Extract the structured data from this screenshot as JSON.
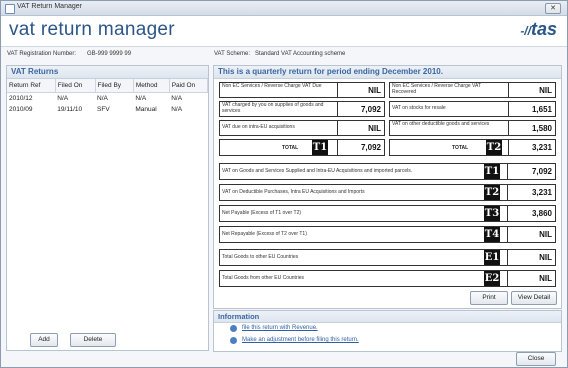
{
  "window": {
    "title": "VAT Return Manager",
    "close_label": "✕"
  },
  "header": {
    "app_title": "vat return manager",
    "logo": "tas"
  },
  "info_bar": {
    "reg_label": "VAT Registration Number:",
    "reg_value": "GB-999 9999 99",
    "scheme_label": "VAT Scheme:",
    "scheme_value": "Standard VAT Accounting scheme"
  },
  "vat_returns": {
    "heading": "VAT Returns",
    "columns": [
      "Return Ref",
      "Filed On",
      "Filed By",
      "Method",
      "Paid On"
    ],
    "rows": [
      [
        "2010/12",
        "N/A",
        "N/A",
        "N/A",
        "N/A"
      ],
      [
        "2010/09",
        "19/11/10",
        "SFV",
        "Manual",
        "N/A"
      ]
    ],
    "add_label": "Add",
    "delete_label": "Delete"
  },
  "return_detail": {
    "heading": "This is a quarterly return for period ending December 2010.",
    "boxes": [
      {
        "label": "Non EC Services / Reverse Charge VAT Due",
        "value": "NIL"
      },
      {
        "label": "Non EC Services / Reverse Charge VAT Recovered",
        "value": "NIL"
      },
      {
        "label": "VAT charged by you on supplies of goods and services",
        "value": "7,092"
      },
      {
        "label": "VAT on stocks for resale",
        "value": "1,651"
      },
      {
        "label": "VAT due on intra-EU acquisitions",
        "value": "NIL"
      },
      {
        "label": "VAT on other deductible goods and services",
        "value": "1,580"
      }
    ],
    "totals": [
      {
        "label": "TOTAL",
        "tag": "T1",
        "value": "7,092"
      },
      {
        "label": "TOTAL",
        "tag": "T2",
        "value": "3,231"
      }
    ],
    "summary_rows": [
      {
        "label": "VAT on Goods and Services Supplied and Intra-EU Acquisitions and imported parcels.",
        "tag": "T1",
        "value": "7,092"
      },
      {
        "label": "VAT on Deductible Purchases, Intra EU Acquisitions and Imports",
        "tag": "T2",
        "value": "3,231"
      },
      {
        "label": "Net Payable (Excess of T1 over T2)",
        "tag": "T3",
        "value": "3,860"
      },
      {
        "label": "Net Repayable (Excess of T2 over T1)",
        "tag": "T4",
        "value": "NIL"
      },
      {
        "label": "Total Goods to other EU Countries",
        "tag": "E1",
        "value": "NIL"
      },
      {
        "label": "Total Goods from other EU Countries",
        "tag": "E2",
        "value": "NIL"
      }
    ],
    "print_label": "Print",
    "view_detail_label": "View Detail"
  },
  "information": {
    "heading": "Information",
    "link1": "file this return with Revenue.",
    "link2": "Make an adjustment before filing this return."
  },
  "footer": {
    "close_label": "Close"
  },
  "colors": {
    "accent": "#3a66a0",
    "title": "#2b5687",
    "tag_bg": "#111111"
  }
}
